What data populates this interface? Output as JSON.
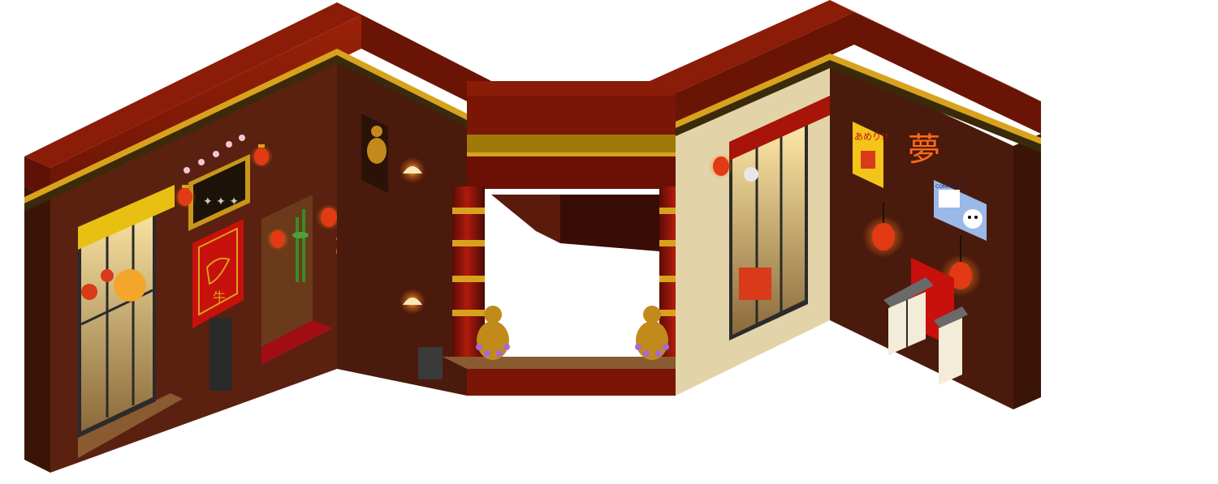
{
  "scene": {
    "title": "",
    "palette": {
      "wall_dark": "#3b1408",
      "wall": "#5a2110",
      "wall_mid": "#6b2a14",
      "roof_top": "#8a1c08",
      "roof_side": "#5e1206",
      "gold": "#d9a21c",
      "gold_dark": "#8c5a08",
      "red": "#c8100c",
      "lantern": "#e23a14",
      "glow": "#ffcc55",
      "window_frame": "#2b2b2b",
      "floor_wood": "#8a5a30",
      "sky_white": "#ffffff"
    },
    "signs": {
      "noodle_ad_text": "あめり!!",
      "neon_glyph_left": "夢",
      "neon_glyph_right": "夢",
      "ox_banner_glyph": "牛",
      "cat_poster_header": "COMM NEWS"
    },
    "icons": [
      "lantern-icon",
      "buddha-statue-icon",
      "maneki-neko-icon",
      "pagoda-lamp-icon",
      "bamboo-icon"
    ]
  }
}
